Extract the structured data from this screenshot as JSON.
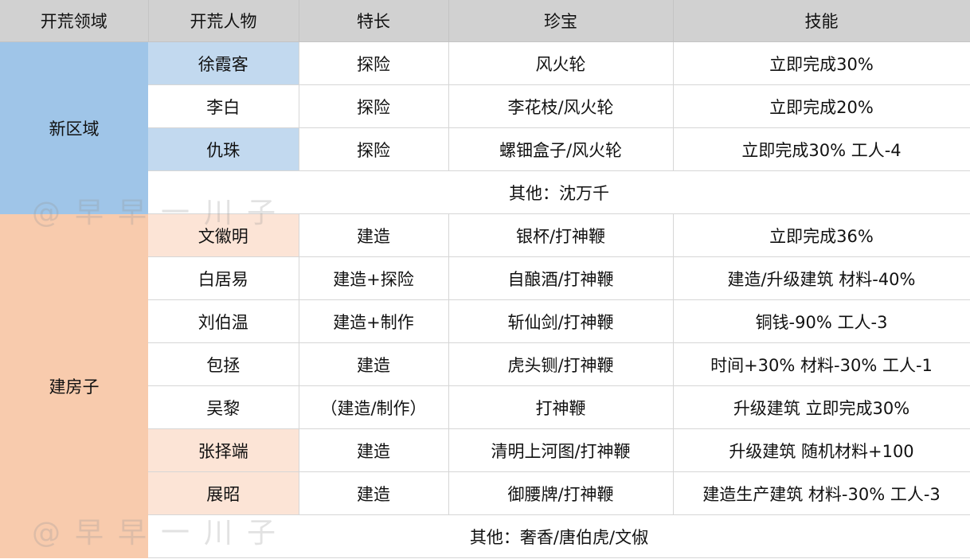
{
  "headers": [
    "开荒领域",
    "开荒人物",
    "特长",
    "珍宝",
    "技能"
  ],
  "groups": [
    {
      "region": "新区域",
      "rows": [
        {
          "person": "徐霞客",
          "specialty": "探险",
          "treasure": "风火轮",
          "skill": "立即完成30%"
        },
        {
          "person": "李白",
          "specialty": "探险",
          "treasure": "李花枝/风火轮",
          "skill": "立即完成20%"
        },
        {
          "person": "仇珠",
          "specialty": "探险",
          "treasure": "螺钿盒子/风火轮",
          "skill": "立即完成30% 工人-4"
        }
      ],
      "other": "其他：沈万千"
    },
    {
      "region": "建房子",
      "rows": [
        {
          "person": "文徽明",
          "specialty": "建造",
          "treasure": "银杯/打神鞭",
          "skill": "立即完成36%"
        },
        {
          "person": "白居易",
          "specialty": "建造+探险",
          "treasure": "自酿酒/打神鞭",
          "skill": "建造/升级建筑 材料-40%"
        },
        {
          "person": "刘伯温",
          "specialty": "建造+制作",
          "treasure": "斩仙剑/打神鞭",
          "skill": "铜钱-90% 工人-3"
        },
        {
          "person": "包拯",
          "specialty": "建造",
          "treasure": "虎头铡/打神鞭",
          "skill": "时间+30% 材料-30% 工人-1"
        },
        {
          "person": "吴黎",
          "specialty": "（建造/制作）",
          "treasure": "打神鞭",
          "skill": "升级建筑 立即完成30%"
        },
        {
          "person": "张择端",
          "specialty": "建造",
          "treasure": "清明上河图/打神鞭",
          "skill": "升级建筑 随机材料+100"
        },
        {
          "person": "展昭",
          "specialty": "建造",
          "treasure": "御腰牌/打神鞭",
          "skill": "建造生产建筑 材料-30% 工人-3"
        }
      ],
      "other": "其他：奢香/唐伯虎/文俶"
    }
  ],
  "watermark": "@早早一川子",
  "colors": {
    "header_bg": "#d1d1d1",
    "region1_bg": "#9fc5e8",
    "person1_bg": "#c2d9ef",
    "region2_bg": "#f8cbad",
    "person2_bg": "#fce4d6"
  }
}
